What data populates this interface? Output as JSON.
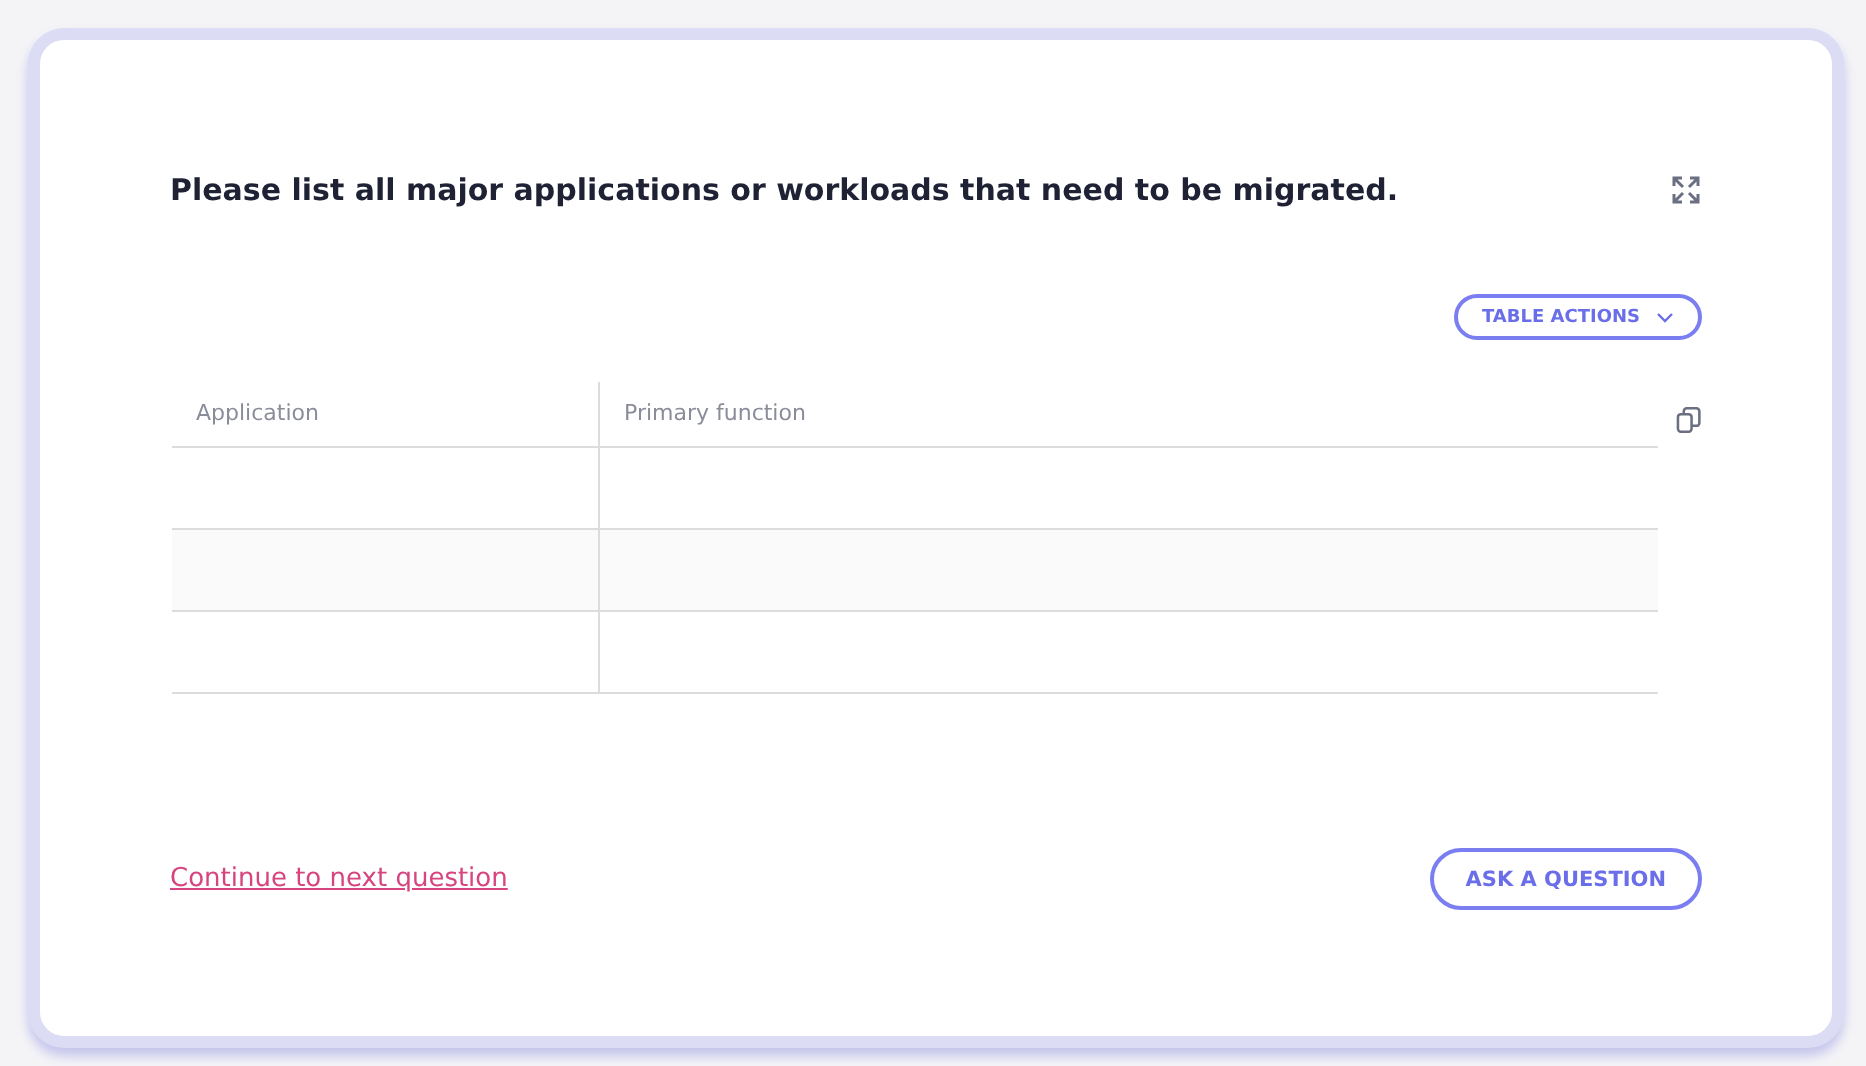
{
  "question": {
    "title": "Please list all major applications or workloads that need to be migrated."
  },
  "table_actions": {
    "label": "TABLE ACTIONS"
  },
  "table": {
    "columns": [
      "Application",
      "Primary function"
    ]
  },
  "footer": {
    "link": "Continue to next question",
    "button": "ASK A QUESTION"
  }
}
